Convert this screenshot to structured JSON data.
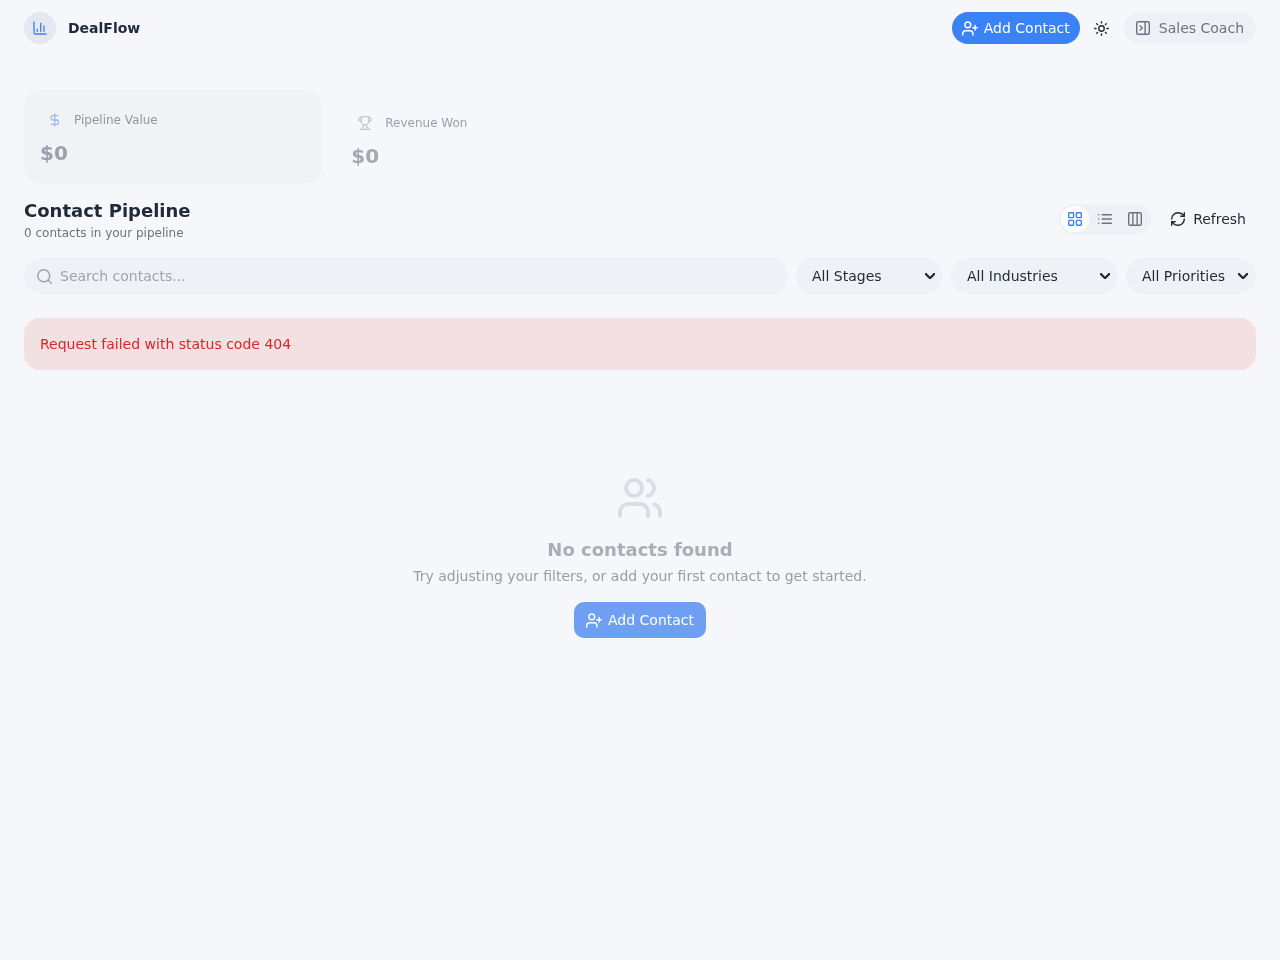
{
  "header": {
    "brand": "DealFlow",
    "add_contact_button": "Add Contact",
    "sales_coach_button": "Sales Coach"
  },
  "stats": [
    {
      "kind": "dollar",
      "label": "Pipeline Value",
      "value": "$0"
    },
    {
      "kind": "trophy",
      "label": "Revenue Won",
      "value": "$0"
    }
  ],
  "pipeline": {
    "title": "Contact Pipeline",
    "subtitle": "0 contacts in your pipeline",
    "view_toggles": [
      {
        "kind": "grid",
        "selected": true
      },
      {
        "kind": "list",
        "selected": false
      },
      {
        "kind": "columns",
        "selected": false
      }
    ],
    "refresh_button": "Refresh"
  },
  "filters": {
    "search": {
      "placeholder": "Search contacts..."
    },
    "selects": [
      {
        "kind": "stage",
        "value": "All Stages"
      },
      {
        "kind": "industry",
        "value": "All Industries"
      },
      {
        "kind": "priority",
        "value": "All Priorities"
      }
    ]
  },
  "error": {
    "message": "Request failed with status code 404"
  },
  "empty_state": {
    "title": "No contacts found",
    "message": "Try adjusting your filters, or add your first contact to get started.",
    "button": "Add Contact"
  }
}
